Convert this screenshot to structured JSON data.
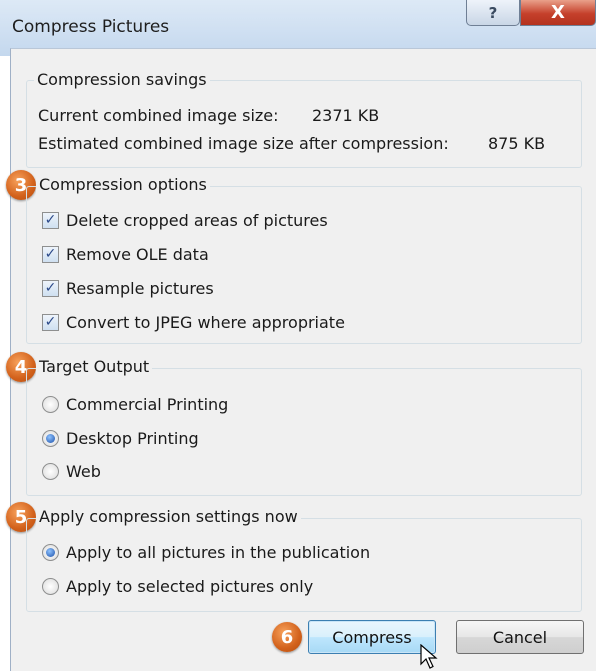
{
  "window": {
    "title": "Compress Pictures",
    "help_label": "?",
    "close_label": "X"
  },
  "savings": {
    "legend": "Compression savings",
    "current_label": "Current combined image size:",
    "current_value": "2371 KB",
    "estimated_label": "Estimated combined image size after compression:",
    "estimated_value": "875 KB"
  },
  "options": {
    "badge": "3",
    "legend": "Compression options",
    "items": [
      {
        "label": "Delete cropped areas of pictures",
        "checked": true
      },
      {
        "label": "Remove OLE data",
        "checked": true
      },
      {
        "label": "Resample pictures",
        "checked": true
      },
      {
        "label": "Convert to JPEG where appropriate",
        "checked": true
      }
    ],
    "check_glyph": "✓"
  },
  "target": {
    "badge": "4",
    "legend": "Target Output",
    "items": [
      {
        "label": "Commercial Printing",
        "selected": false
      },
      {
        "label": "Desktop Printing",
        "selected": true
      },
      {
        "label": "Web",
        "selected": false
      }
    ]
  },
  "apply": {
    "badge": "5",
    "legend": "Apply compression settings now",
    "items": [
      {
        "label": "Apply to all pictures in the publication",
        "selected": true
      },
      {
        "label": "Apply to selected pictures only",
        "selected": false
      }
    ]
  },
  "buttons": {
    "badge": "6",
    "compress": "Compress",
    "cancel": "Cancel"
  }
}
